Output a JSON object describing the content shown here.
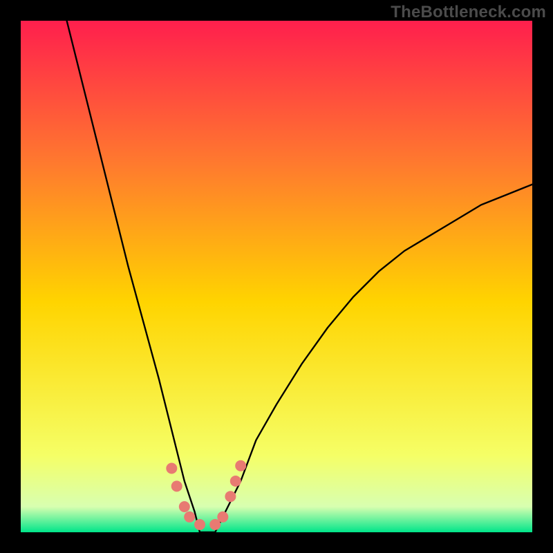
{
  "watermark": "TheBottleneck.com",
  "chart_data": {
    "type": "line",
    "title": "",
    "xlabel": "",
    "ylabel": "",
    "xlim": [
      0,
      100
    ],
    "ylim": [
      0,
      100
    ],
    "grid": false,
    "legend": false,
    "note": "V-shaped bottleneck curve on a red-to-green gradient. Values estimated from pixels; minimum ≈ x 35.",
    "curve": {
      "name": "bottleneck",
      "x": [
        9,
        12,
        15,
        18,
        21,
        24,
        27,
        30,
        32,
        34,
        35,
        38,
        40,
        43,
        46,
        50,
        55,
        60,
        65,
        70,
        75,
        80,
        85,
        90,
        95,
        100
      ],
      "y": [
        100,
        88,
        76,
        64,
        52,
        41,
        30,
        18,
        10,
        4,
        0,
        0,
        4,
        10,
        18,
        25,
        33,
        40,
        46,
        51,
        55,
        58,
        61,
        64,
        66,
        68
      ]
    },
    "markers": {
      "name": "highlight-dots",
      "note": "Salmon dots clustered near the trough of the V",
      "points": [
        {
          "x": 29.5,
          "y": 12.5
        },
        {
          "x": 30.5,
          "y": 9
        },
        {
          "x": 32,
          "y": 5
        },
        {
          "x": 33,
          "y": 3
        },
        {
          "x": 35,
          "y": 1.5
        },
        {
          "x": 38,
          "y": 1.5
        },
        {
          "x": 39.5,
          "y": 3
        },
        {
          "x": 41,
          "y": 7
        },
        {
          "x": 42,
          "y": 10
        },
        {
          "x": 43,
          "y": 13
        }
      ],
      "radius_px": 8
    },
    "background_gradient": {
      "top_color": "#ff1f4d",
      "upper_mid_color": "#ff7a2e",
      "mid_color": "#ffd400",
      "lower_mid_color": "#f5ff66",
      "near_bottom_color": "#d8ffb0",
      "bottom_color": "#00e58a"
    }
  }
}
